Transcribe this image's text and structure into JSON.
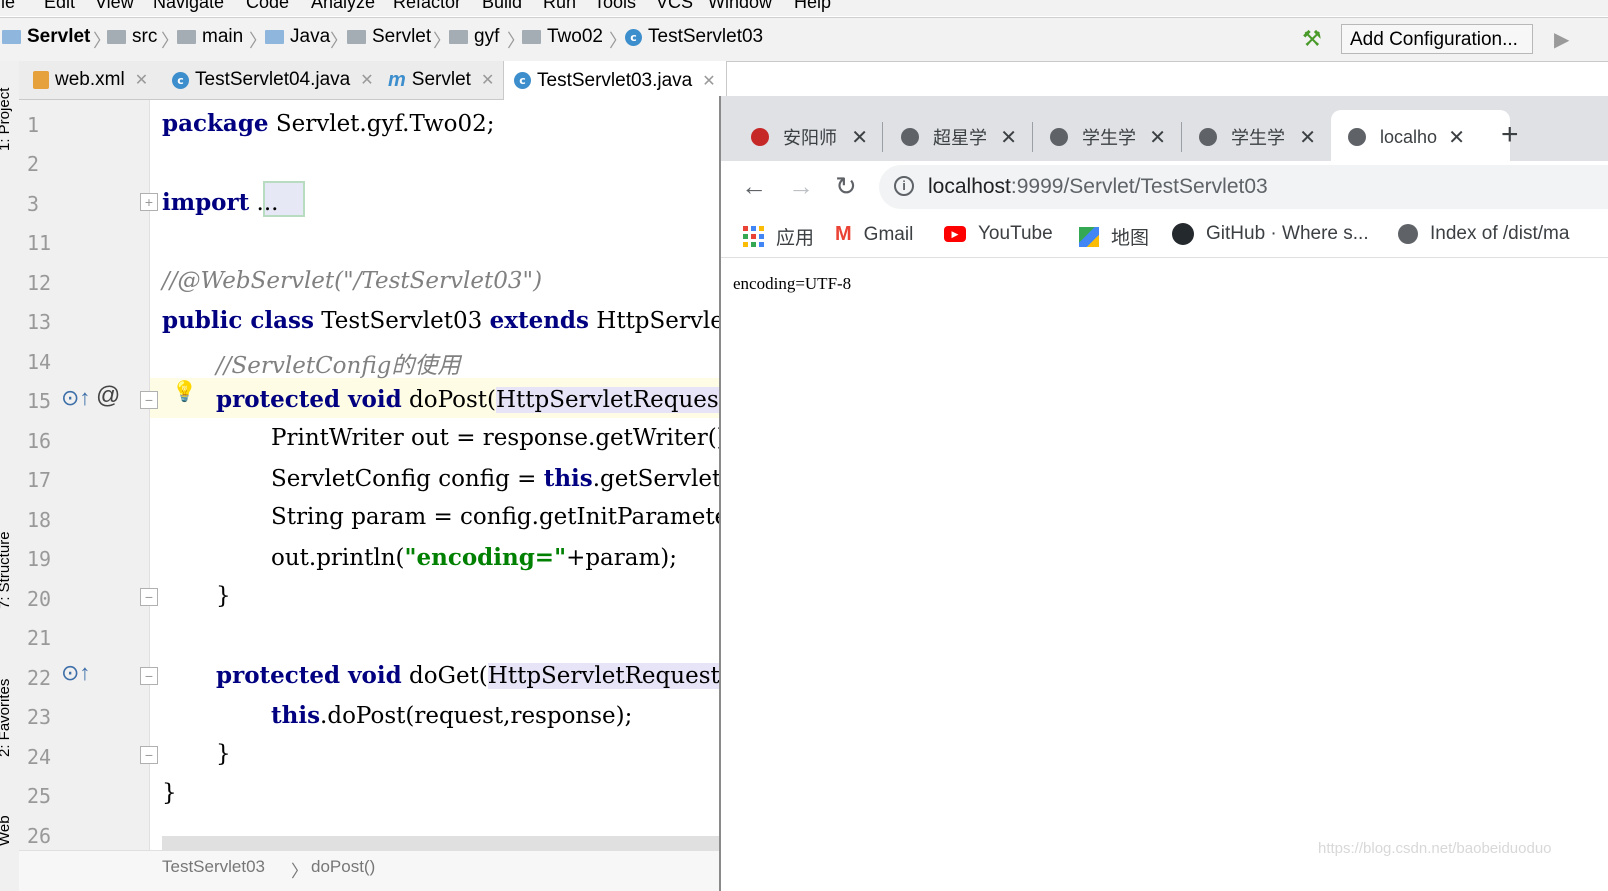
{
  "ide": {
    "menu": [
      "File",
      "Edit",
      "View",
      "Navigate",
      "Code",
      "Analyze",
      "Refactor",
      "Build",
      "Run",
      "Tools",
      "VCS",
      "Window",
      "Help"
    ],
    "breadcrumb": [
      "Servlet",
      "src",
      "main",
      "Java",
      "Servlet",
      "gyf",
      "Two02",
      "TestServlet03"
    ],
    "add_configuration": "Add Configuration...",
    "tool_windows": [
      "1: Project",
      "7: Structure",
      "2: Favorites",
      "Web"
    ],
    "editor_tabs": [
      {
        "label": "web.xml",
        "icon": "xml-file-icon"
      },
      {
        "label": "TestServlet04.java",
        "icon": "class-icon"
      },
      {
        "label": "Servlet",
        "icon": "module-icon"
      },
      {
        "label": "TestServlet03.java",
        "icon": "class-icon",
        "active": true
      }
    ],
    "line_numbers": [
      "1",
      "2",
      "3",
      "11",
      "12",
      "13",
      "14",
      "15",
      "16",
      "17",
      "18",
      "19",
      "20",
      "21",
      "22",
      "23",
      "24",
      "25",
      "26"
    ],
    "code": {
      "l1_kw": "package",
      "l1_rest": " Servlet.gyf.Two02;",
      "l3_kw": "import",
      "l3_rest": " ...",
      "l12": "//@WebServlet(\"/TestServlet03\")",
      "l13_kw": "public class",
      "l13_mid": " TestServlet03 ",
      "l13_kw2": "extends",
      "l13_rest": " HttpServlet {",
      "l14": "//ServletConfig的使用",
      "l15_kw": "protected void",
      "l15_rest": " doPost(",
      "l15_param": "HttpServletRequest request, HttpServletResponse response)",
      "l16": "PrintWriter out = response.getWriter();",
      "l17_pre": "ServletConfig config = ",
      "l17_kw": "this",
      "l17_rest": ".getServletConfig();",
      "l18": "String param = config.getInitParameter(\"encoding\");",
      "l19_pre": "out.println(",
      "l19_str": "\"encoding=\"",
      "l19_rest": "+param);",
      "l20": "}",
      "l22_kw": "protected void",
      "l22_rest": " doGet(",
      "l22_param": "HttpServletRequest request, HttpServletResponse response)",
      "l23_kw": "this",
      "l23_rest": ".doPost(request,response);",
      "l24": "}",
      "l25": "}"
    },
    "editor_breadcrumb": [
      "TestServlet03",
      "doPost()"
    ]
  },
  "browser": {
    "tabs": [
      {
        "title": "安阳师",
        "icon": "university-icon"
      },
      {
        "title": "超星学",
        "icon": "globe-icon"
      },
      {
        "title": "学生学",
        "icon": "globe-icon"
      },
      {
        "title": "学生学",
        "icon": "globe-icon"
      },
      {
        "title": "localho",
        "icon": "globe-icon",
        "active": true
      }
    ],
    "url_host": "localhost",
    "url_path": ":9999/Servlet/TestServlet03",
    "bookmarks": [
      {
        "label": "应用",
        "icon": "apps-icon"
      },
      {
        "label": "Gmail",
        "icon": "gmail-icon"
      },
      {
        "label": "YouTube",
        "icon": "youtube-icon"
      },
      {
        "label": "地图",
        "icon": "maps-icon"
      },
      {
        "label": "GitHub · Where s...",
        "icon": "github-icon"
      },
      {
        "label": "Index of /dist/ma",
        "icon": "globe-icon"
      }
    ],
    "page_text": "encoding=UTF-8"
  },
  "watermark": "https://blog.csdn.net/baobeiduoduo",
  "colors": {
    "keyword": "#000080",
    "string": "#008000",
    "comment": "#808080",
    "line_number": "#999999"
  }
}
